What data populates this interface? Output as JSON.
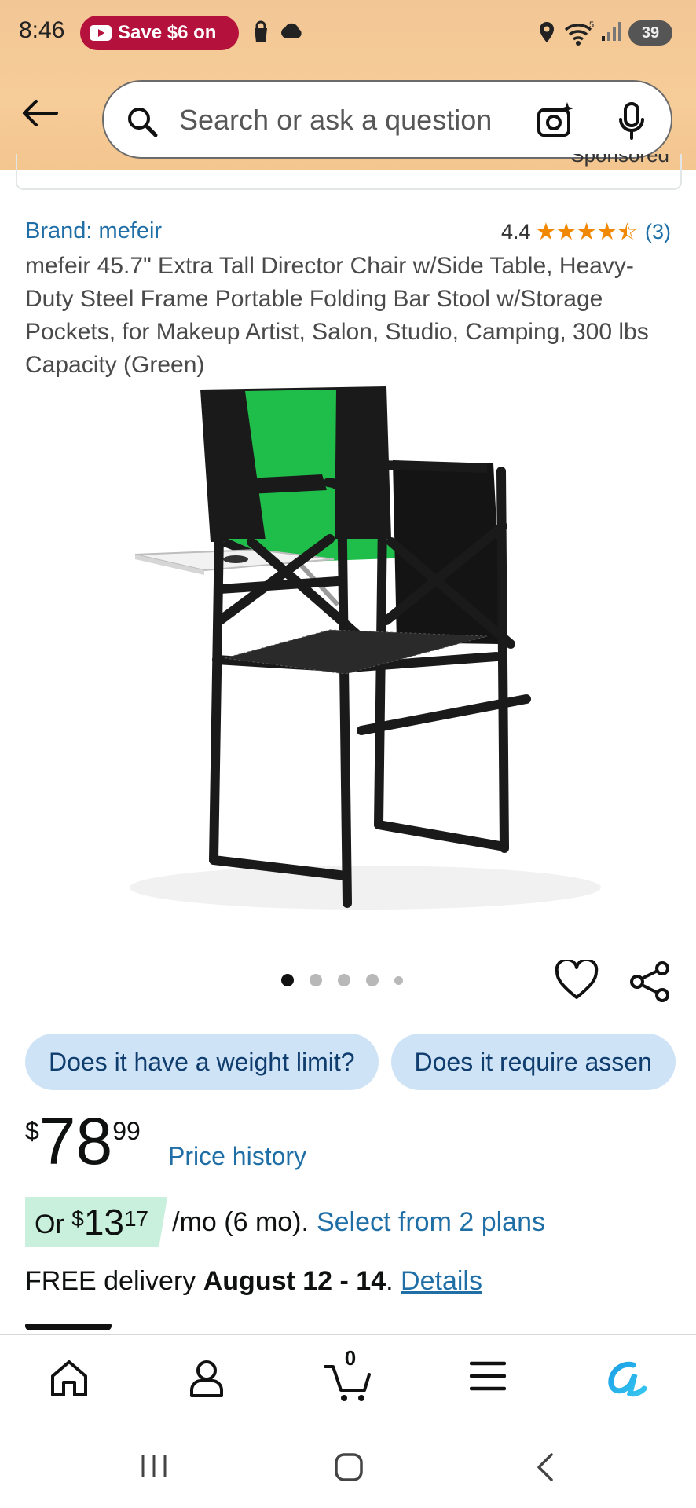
{
  "status_bar": {
    "time": "8:46",
    "promo_pill": "Save $6 on",
    "wifi_label": "5",
    "battery": "39"
  },
  "search": {
    "placeholder": "Search or ask a question"
  },
  "sponsored": {
    "label": "Sponsored"
  },
  "product": {
    "brand": "Brand: mefeir",
    "rating_value": "4.4",
    "rating_stars": 4.4,
    "rating_count": "(3)",
    "title": "mefeir 45.7\" Extra Tall Director Chair w/Side Table, Heavy-Duty Steel Frame Portable Folding Bar Stool w/Storage Pockets, for Makeup Artist, Salon, Studio, Camping, 300 lbs Capacity (Green)",
    "image_count": 5,
    "image_index": 1,
    "colors": {
      "seat": "#1fbe4a",
      "frame": "#1a1a1a"
    }
  },
  "questions": [
    "Does it have a weight limit?",
    "Does it require assen"
  ],
  "price": {
    "currency": "$",
    "whole": "78",
    "fraction": "99",
    "history_link": "Price history"
  },
  "plan": {
    "prefix": "Or",
    "currency": "$",
    "whole": "13",
    "fraction": "17",
    "term": "/mo (6 mo).",
    "link": "Select from 2 plans"
  },
  "delivery": {
    "prefix": "FREE delivery",
    "dates": "August 12 - 14",
    "suffix": ".",
    "details_link": "Details"
  },
  "bottom_nav": {
    "cart_count": "0",
    "items": [
      "home-icon",
      "account-icon",
      "cart-icon",
      "menu-icon",
      "rufus-icon"
    ]
  },
  "colors": {
    "header_bg": "#f6cc98",
    "link": "#1f6fa6",
    "star": "#f08804",
    "chip_bg": "#cfe3f7",
    "plan_highlight": "#c8f0dc"
  }
}
